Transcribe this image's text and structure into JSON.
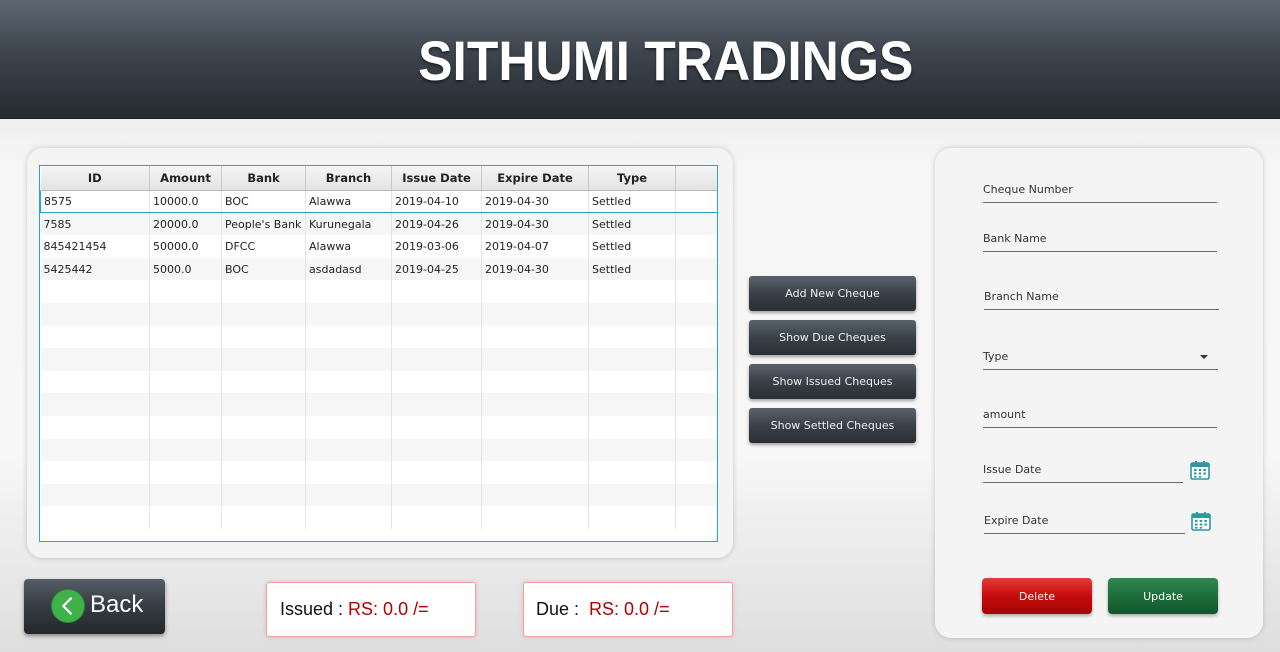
{
  "app": {
    "title": "SITHUMI TRADINGS"
  },
  "table": {
    "columns": [
      "ID",
      "Amount",
      "Bank",
      "Branch",
      "Issue Date",
      "Expire Date",
      "Type",
      ""
    ],
    "rows": [
      [
        "8575",
        "10000.0",
        "BOC",
        "Alawwa",
        "2019-04-10",
        "2019-04-30",
        "Settled",
        ""
      ],
      [
        "7585",
        "20000.0",
        "People's Bank",
        "Kurunegala",
        "2019-04-26",
        "2019-04-30",
        "Settled",
        ""
      ],
      [
        "845421454",
        "50000.0",
        "DFCC",
        "Alawwa",
        "2019-03-06",
        "2019-04-07",
        "Settled",
        ""
      ],
      [
        "5425442",
        "5000.0",
        "BOC",
        "asdadasd",
        "2019-04-25",
        "2019-04-30",
        "Settled",
        ""
      ],
      [
        "",
        "",
        "",
        "",
        "",
        "",
        "",
        ""
      ],
      [
        "",
        "",
        "",
        "",
        "",
        "",
        "",
        ""
      ],
      [
        "",
        "",
        "",
        "",
        "",
        "",
        "",
        ""
      ],
      [
        "",
        "",
        "",
        "",
        "",
        "",
        "",
        ""
      ],
      [
        "",
        "",
        "",
        "",
        "",
        "",
        "",
        ""
      ],
      [
        "",
        "",
        "",
        "",
        "",
        "",
        "",
        ""
      ],
      [
        "",
        "",
        "",
        "",
        "",
        "",
        "",
        ""
      ],
      [
        "",
        "",
        "",
        "",
        "",
        "",
        "",
        ""
      ],
      [
        "",
        "",
        "",
        "",
        "",
        "",
        "",
        ""
      ],
      [
        "",
        "",
        "",
        "",
        "",
        "",
        "",
        ""
      ],
      [
        "",
        "",
        "",
        "",
        "",
        "",
        "",
        ""
      ]
    ]
  },
  "actions": {
    "add": "Add New Cheque",
    "due": "Show Due Cheques",
    "issued": "Show Issued Cheques",
    "settled": "Show Settled Cheques"
  },
  "form": {
    "cheque_number": "Cheque Number",
    "bank_name": "Bank Name",
    "branch_name": "Branch Name",
    "type": "Type",
    "amount": "amount",
    "issue_date": "Issue Date",
    "expire_date": "Expire Date",
    "delete": "Delete",
    "update": "Update"
  },
  "footer": {
    "back": "Back",
    "issued_label": "Issued :",
    "issued_value": "RS: 0.0 /=",
    "due_label": "Due :",
    "due_value": "RS: 0.0 /="
  },
  "icons": {
    "back": "chevron-left-icon",
    "calendar": "calendar-icon",
    "dropdown": "chevron-down-icon"
  },
  "colors": {
    "header": "#2f353c",
    "table_border": "#2aa3cf",
    "delete": "#c60a0a",
    "update": "#1d6e3a",
    "back_circle": "#3fb24a",
    "amount_value": "#b30000"
  }
}
